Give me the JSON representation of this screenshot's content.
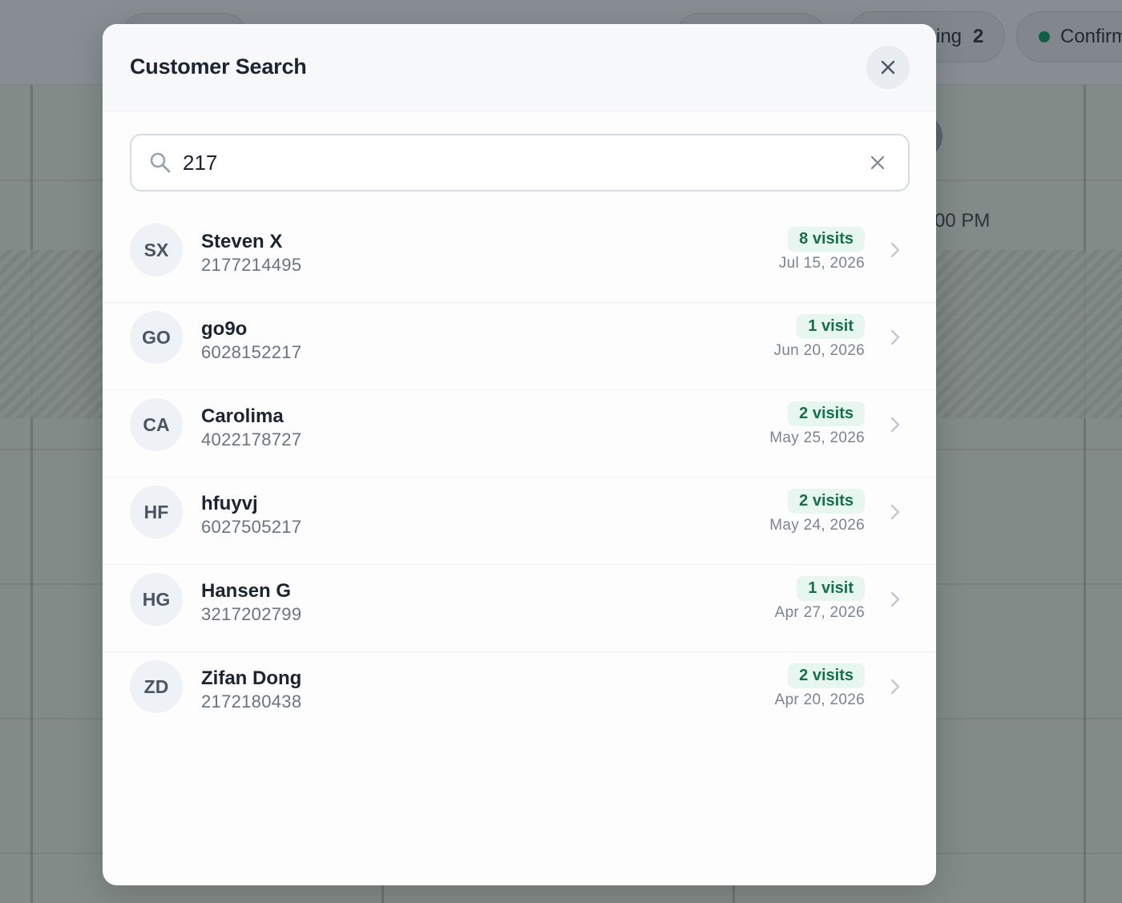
{
  "background": {
    "status_pills": [
      {
        "label": "ing",
        "count": "2"
      },
      {
        "label": "Confirm",
        "dot_color": "#0f5f45"
      }
    ],
    "time_label": "00 PM"
  },
  "modal": {
    "title": "Customer Search",
    "close_icon": "close-icon",
    "search": {
      "value": "217",
      "icon": "search-icon",
      "clear_icon": "clear-icon"
    },
    "results": [
      {
        "initials": "SX",
        "name": "Steven X",
        "phone": "2177214495",
        "visits": "8 visits",
        "date": "Jul 15, 2026"
      },
      {
        "initials": "GO",
        "name": "go9o",
        "phone": "6028152217",
        "visits": "1 visit",
        "date": "Jun 20, 2026"
      },
      {
        "initials": "CA",
        "name": "Carolima",
        "phone": "4022178727",
        "visits": "2 visits",
        "date": "May 25, 2026"
      },
      {
        "initials": "HF",
        "name": "hfuyvj",
        "phone": "6027505217",
        "visits": "2 visits",
        "date": "May 24, 2026"
      },
      {
        "initials": "HG",
        "name": "Hansen G",
        "phone": "3217202799",
        "visits": "1 visit",
        "date": "Apr 27, 2026"
      },
      {
        "initials": "ZD",
        "name": "Zifan Dong",
        "phone": "2172180438",
        "visits": "2 visits",
        "date": "Apr 20, 2026"
      }
    ]
  },
  "colors": {
    "accent_green": "#14704f",
    "badge_bg": "#e8f6f0",
    "overlay": "#888d94"
  }
}
